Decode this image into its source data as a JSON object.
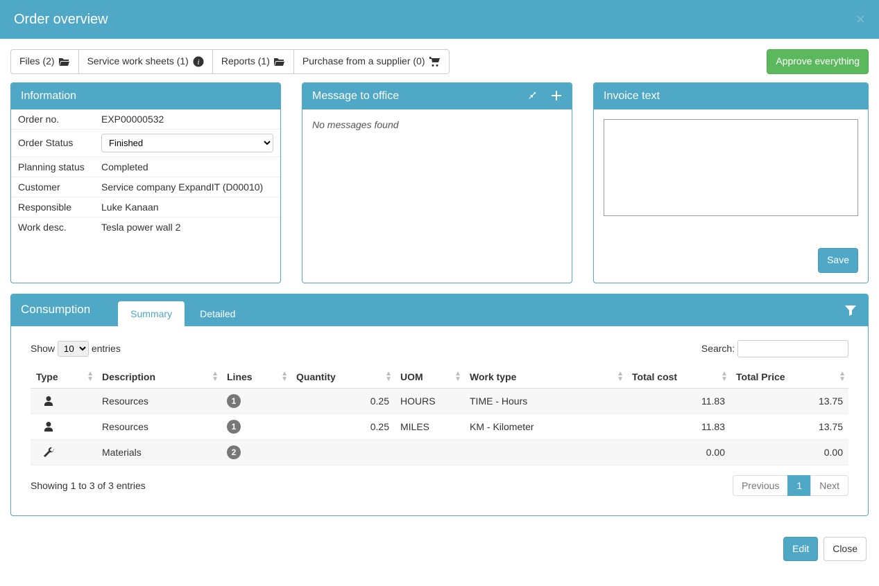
{
  "header": {
    "title": "Order overview"
  },
  "toolbar": {
    "files": "Files (2) ",
    "sheets": "Service work sheets (1) ",
    "reports": "Reports (1) ",
    "purchase": "Purchase from a supplier (0) ",
    "approve": "Approve everything"
  },
  "info": {
    "heading": "Information",
    "labels": {
      "order_no": "Order no.",
      "order_status": "Order Status",
      "planning_status": "Planning status",
      "customer": "Customer",
      "responsible": "Responsible",
      "work_desc": "Work desc."
    },
    "values": {
      "order_no": "EXP00000532",
      "order_status": "Finished",
      "planning_status": "Completed",
      "customer": "Service company ExpandIT (D00010)",
      "responsible": "Luke Kanaan",
      "work_desc": "Tesla power wall 2"
    }
  },
  "messages": {
    "heading": "Message to office",
    "empty": "No messages found"
  },
  "invoice": {
    "heading": "Invoice text",
    "save": "Save"
  },
  "consumption": {
    "heading": "Consumption",
    "tabs": {
      "summary": "Summary",
      "detailed": "Detailed"
    },
    "show": "Show",
    "entries": "entries",
    "show_value": "10",
    "search_label": "Search:",
    "columns": {
      "type": "Type",
      "description": "Description",
      "lines": "Lines",
      "quantity": "Quantity",
      "uom": "UOM",
      "work_type": "Work type",
      "total_cost": "Total cost",
      "total_price": "Total Price"
    },
    "rows": [
      {
        "icon": "person",
        "description": "Resources",
        "lines": "1",
        "quantity": "0.25",
        "uom": "HOURS",
        "work_type": "TIME - Hours",
        "total_cost": "11.83",
        "total_price": "13.75"
      },
      {
        "icon": "person",
        "description": "Resources",
        "lines": "1",
        "quantity": "0.25",
        "uom": "MILES",
        "work_type": "KM - Kilometer",
        "total_cost": "11.83",
        "total_price": "13.75"
      },
      {
        "icon": "wrench",
        "description": "Materials",
        "lines": "2",
        "quantity": "",
        "uom": "",
        "work_type": "",
        "total_cost": "0.00",
        "total_price": "0.00"
      }
    ],
    "showing": "Showing 1 to 3 of 3 entries",
    "pager": {
      "prev": "Previous",
      "page": "1",
      "next": "Next"
    }
  },
  "footer": {
    "edit": "Edit",
    "close": "Close"
  }
}
